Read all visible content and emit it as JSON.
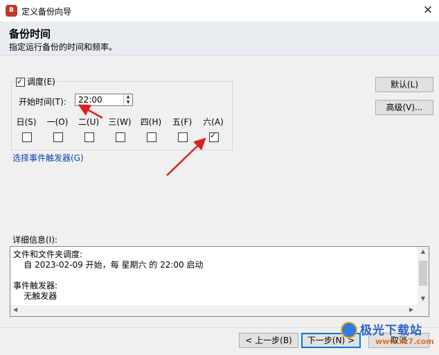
{
  "window": {
    "title": "定义备份向导",
    "app_icon_text": "B"
  },
  "header": {
    "title": "备份时间",
    "subtitle": "指定运行备份的时间和频率。"
  },
  "schedule": {
    "enable_label": "调度(E)",
    "enabled": true,
    "start_time_label": "开始时间(T):",
    "start_time_value": "22:00",
    "days": [
      {
        "label": "日(S)",
        "checked": false
      },
      {
        "label": "一(O)",
        "checked": false
      },
      {
        "label": "二(U)",
        "checked": false
      },
      {
        "label": "三(W)",
        "checked": false
      },
      {
        "label": "四(H)",
        "checked": false
      },
      {
        "label": "五(F)",
        "checked": false
      },
      {
        "label": "六(A)",
        "checked": true
      }
    ]
  },
  "event_trigger_link": "选择事件触发器(G)",
  "side_buttons": {
    "default": "默认(L)",
    "advanced": "高级(V)..."
  },
  "details": {
    "label": "详细信息(I):",
    "lines": [
      "文件和文件夹调度:",
      "    自 2023-02-09 开始，每 星期六 的 22:00 启动",
      "",
      "事件触发器:",
      "    无触发器"
    ]
  },
  "footer": {
    "back": "< 上一步(B)",
    "next": "下一步(N) >",
    "cancel": "取消"
  },
  "watermark": {
    "brand": "极光下载站",
    "url": "www.xz7.com"
  },
  "colors": {
    "annotation_arrow": "#e02020",
    "link": "#0645ad",
    "focus_border": "#0078d7"
  }
}
